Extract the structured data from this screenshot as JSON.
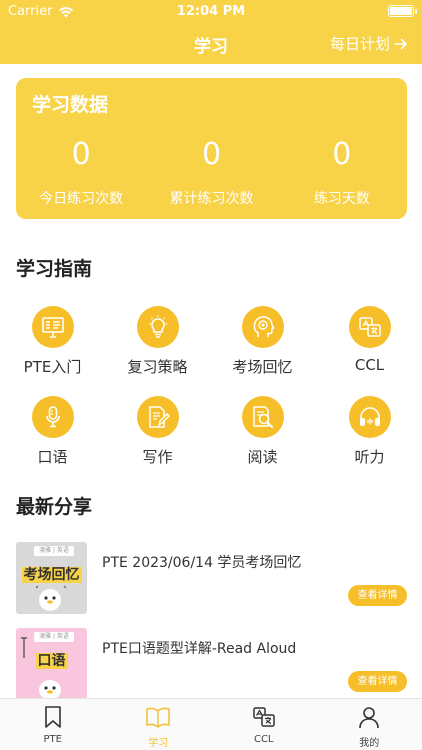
{
  "status": {
    "carrier": "Carrier",
    "time": "12:04 PM"
  },
  "navbar": {
    "title": "学习",
    "plan_label": "每日计划"
  },
  "stats": {
    "title": "学习数据",
    "items": [
      {
        "value": "0",
        "label": "今日练习次数"
      },
      {
        "value": "0",
        "label": "累计练习次数"
      },
      {
        "value": "0",
        "label": "练习天数"
      }
    ]
  },
  "guide": {
    "title": "学习指南",
    "items": [
      {
        "label": "PTE入门",
        "icon": "presentation-icon"
      },
      {
        "label": "复习策略",
        "icon": "lightbulb-icon"
      },
      {
        "label": "考场回忆",
        "icon": "head-memory-icon"
      },
      {
        "label": "CCL",
        "icon": "translate-icon"
      },
      {
        "label": "口语",
        "icon": "microphone-icon"
      },
      {
        "label": "写作",
        "icon": "document-pen-icon"
      },
      {
        "label": "阅读",
        "icon": "document-search-icon"
      },
      {
        "label": "听力",
        "icon": "headphones-icon"
      }
    ]
  },
  "shares": {
    "title": "最新分享",
    "items": [
      {
        "title": "PTE 2023/06/14 学员考场回忆",
        "thumb_tag": "澳雅 | 英语",
        "thumb_word": "考场回忆",
        "thumb_bg": "#D9D9D9",
        "button": "查看详情"
      },
      {
        "title": "PTE口语题型详解-Read Aloud",
        "thumb_tag": "澳雅 | 英语",
        "thumb_word": "口语",
        "thumb_bg": "#F9C7DD",
        "button": "查看详情"
      }
    ]
  },
  "tabbar": {
    "items": [
      {
        "label": "PTE",
        "icon": "bookmark-icon"
      },
      {
        "label": "学习",
        "icon": "open-book-icon",
        "active": true
      },
      {
        "label": "CCL",
        "icon": "translate-icon"
      },
      {
        "label": "我的",
        "icon": "person-icon"
      }
    ]
  },
  "colors": {
    "brand": "#F8D247",
    "accent": "#F6BF2A"
  }
}
